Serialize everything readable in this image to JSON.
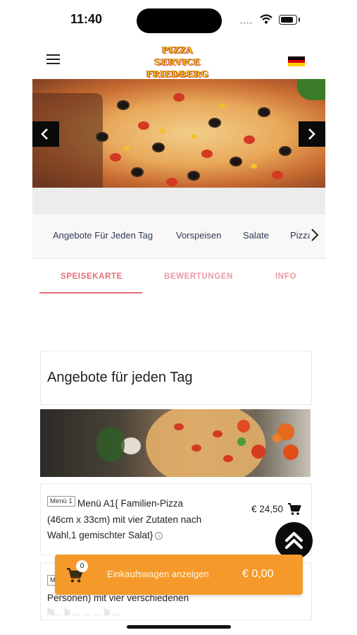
{
  "status_bar": {
    "time": "11:40",
    "signal_dots": "••••"
  },
  "header": {
    "logo_line1": "PIZZA SERVICE",
    "logo_line2": "FRIEDBERG",
    "menu_icon": "hamburger-icon",
    "language_flag": "germany-flag-icon",
    "flag_colors": [
      "#000000",
      "#dd0000",
      "#ffce00"
    ]
  },
  "hero": {
    "prev_icon": "chevron-left-icon",
    "next_icon": "chevron-right-icon"
  },
  "categories": {
    "items": [
      "Angebote Für Jeden Tag",
      "Vorspeisen",
      "Salate",
      "Pizza"
    ],
    "more_icon": "chevron-right-icon"
  },
  "tabs": {
    "items": [
      "SPEISEKARTE",
      "BEWERTUNGEN",
      "INFO"
    ],
    "active": "SPEISEKARTE",
    "accent_color": "#e46d74"
  },
  "section": {
    "title": "Angebote für jeden Tag"
  },
  "items": [
    {
      "badge": "Menü 1",
      "line1": "Menü A1{ Familien-Pizza",
      "line2": "(46cm x 33cm) mit vier Zutaten nach",
      "line3": "Wahl,1 gemischter Salat}",
      "info_icon": "i",
      "price": "€ 24,50"
    },
    {
      "badge": "M",
      "line2": "Personen) mit vier verschiedenen",
      "line3": "N... b ... ... ... b ..."
    }
  ],
  "cart": {
    "count": "0",
    "label": "Einkaufswagen anzeigen",
    "total": "€ 0,00",
    "color": "#f59a2a"
  }
}
